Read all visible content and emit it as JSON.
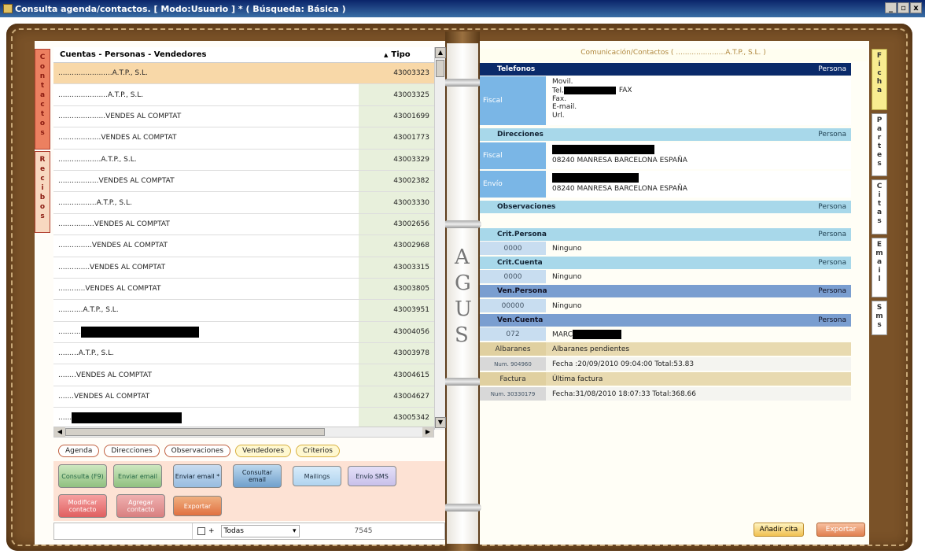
{
  "window": {
    "title": "Consulta agenda/contactos. [ Modo:Usuario ] * ( Búsqueda: Básica )",
    "controls": [
      "_",
      "▫",
      "x"
    ]
  },
  "left_tabs": [
    {
      "label": "Contactos",
      "letters": [
        "C",
        "o",
        "n",
        "t",
        "a",
        "c",
        "t",
        "o",
        "s"
      ]
    },
    {
      "label": "Recibos",
      "letters": [
        "R",
        "e",
        "c",
        "i",
        "b",
        "o",
        "s"
      ]
    }
  ],
  "list": {
    "col_name": "Cuentas - Personas - Vendedores",
    "sort_arrow": "▲",
    "col_type": "Tipo",
    "rows": [
      {
        "name": "........................A.T.P., S.L.",
        "code": "43003323",
        "selected": true
      },
      {
        "name": "......................A.T.P., S.L.",
        "code": "43003325"
      },
      {
        "name": ".....................VENDES AL COMPTAT",
        "code": "43001699"
      },
      {
        "name": "...................VENDES AL COMPTAT",
        "code": "43001773"
      },
      {
        "name": "...................A.T.P., S.L.",
        "code": "43003329"
      },
      {
        "name": "..................VENDES AL COMPTAT",
        "code": "43002382"
      },
      {
        "name": ".................A.T.P., S.L.",
        "code": "43003330"
      },
      {
        "name": "................VENDES AL COMPTAT",
        "code": "43002656"
      },
      {
        "name": "...............VENDES AL COMPTAT",
        "code": "43002968"
      },
      {
        "name": "..............VENDES AL COMPTAT",
        "code": "43003315"
      },
      {
        "name": "............VENDES AL COMPTAT",
        "code": "43003805"
      },
      {
        "name": "...........A.T.P., S.L.",
        "code": "43003951"
      },
      {
        "name": "..........",
        "code": "43004056",
        "redacted": true
      },
      {
        "name": ".........A.T.P., S.L.",
        "code": "43003978"
      },
      {
        "name": "........VENDES AL COMPTAT",
        "code": "43004615"
      },
      {
        "name": ".......VENDES AL COMPTAT",
        "code": "43004627"
      },
      {
        "name": "......",
        "code": "43005342",
        "redacted": true
      }
    ]
  },
  "filters": [
    "Agenda",
    "Direcciones",
    "Observaciones",
    "Vendedores",
    "Criterios"
  ],
  "actions": {
    "consulta": "Consulta (F9)",
    "enviar_email": "Enviar email",
    "enviar_email_plus": "Enviar email *",
    "consultar_email": "Consultar email",
    "mailings": "Mailings",
    "envio_sms": "Envío SMS",
    "modificar": "Modificar contacto",
    "agregar": "Agregar contacto",
    "exportar": "Exportar"
  },
  "statusbar": {
    "checkbox_suffix": "+",
    "filter_value": "Todas",
    "count": "7545"
  },
  "spine_letters": [
    "A",
    "G",
    "U",
    "S"
  ],
  "right": {
    "title": "Comunicación/Contactos ( ......................A.T.P., S.L. )",
    "telefonos": {
      "header": "Telefonos",
      "persona": "Persona",
      "label": "Fiscal",
      "lines": [
        "Movil.",
        "Tel.",
        "Fax.",
        "E-mail.",
        "Url."
      ],
      "fax_tag": "FAX"
    },
    "direcciones": {
      "header": "Direcciones",
      "persona": "Persona",
      "rows": [
        {
          "label": "Fiscal",
          "address": "08240 MANRESA BARCELONA ESPAÑA"
        },
        {
          "label": "Envío",
          "address": "08240 MANRESA BARCELONA ESPAÑA"
        }
      ]
    },
    "observaciones": {
      "header": "Observaciones",
      "persona": "Persona"
    },
    "crit_persona": {
      "header": "Crit.Persona",
      "persona": "Persona",
      "code": "0000",
      "value": "Ninguno"
    },
    "crit_cuenta": {
      "header": "Crit.Cuenta",
      "persona": "Persona",
      "code": "0000",
      "value": "Ninguno"
    },
    "ven_persona": {
      "header": "Ven.Persona",
      "persona": "Persona",
      "code": "00000",
      "value": "Ninguno"
    },
    "ven_cuenta": {
      "header": "Ven.Cuenta",
      "persona": "Persona",
      "code": "072",
      "value": "MARC"
    },
    "albaranes": {
      "key": "Albaranes",
      "value": "Albaranes pendientes"
    },
    "albaran_row": {
      "key": "Num. 904960",
      "value": "Fecha :20/09/2010 09:04:00 Total:53.83"
    },
    "factura": {
      "key": "Factura",
      "value": "Última factura"
    },
    "factura_row": {
      "key": "Num. 30330179",
      "value": "Fecha:31/08/2010 18:07:33 Total:368.66"
    },
    "buttons": {
      "add_cita": "Añadir cita",
      "export": "Exportar"
    }
  },
  "right_tabs": [
    {
      "label": "Ficha",
      "letters": [
        "F",
        "i",
        "c",
        "h",
        "a"
      ],
      "active": true
    },
    {
      "label": "Partes",
      "letters": [
        "P",
        "a",
        "r",
        "t",
        "e",
        "s"
      ]
    },
    {
      "label": "Citas",
      "letters": [
        "C",
        "i",
        "t",
        "a",
        "s"
      ]
    },
    {
      "label": "Email",
      "letters": [
        "E",
        "m",
        "a",
        "i",
        "l"
      ]
    },
    {
      "label": "Sms",
      "letters": [
        "S",
        "m",
        "s"
      ]
    }
  ]
}
